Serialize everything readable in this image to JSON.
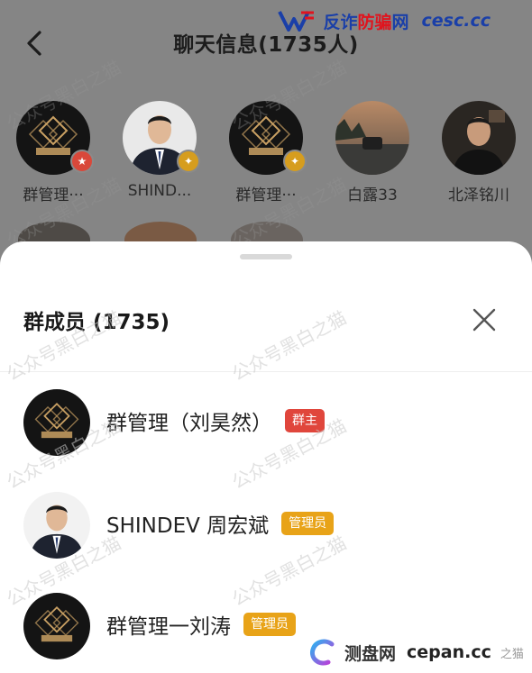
{
  "header": {
    "title": "聊天信息(1735人)"
  },
  "brand": {
    "name_prefix": "反诈",
    "name_highlight": "防骗",
    "name_suffix": "网",
    "domain": "cesc.cc"
  },
  "members_grid": [
    {
      "name": "群管理···",
      "role": "owner"
    },
    {
      "name": "SHIND...",
      "role": "admin"
    },
    {
      "name": "群管理···",
      "role": "admin"
    },
    {
      "name": "白露33",
      "role": ""
    },
    {
      "name": "北泽铭川",
      "role": ""
    }
  ],
  "sheet": {
    "title": "群成员 (1735)",
    "members": [
      {
        "name": "群管理（刘昊然）",
        "tag": "群主",
        "avatar": "logo"
      },
      {
        "name": "SHINDEV 周宏斌",
        "tag": "管理员",
        "avatar": "person"
      },
      {
        "name": "群管理一刘涛",
        "tag": "管理员",
        "avatar": "logo"
      }
    ]
  },
  "watermark": "公众号黑白之猫",
  "footer_brand": {
    "cn": "测盘网",
    "domain": "cepan.cc",
    "tail": "之猫"
  },
  "colors": {
    "owner_tag": "#e0463c",
    "admin_tag": "#e8a318",
    "logo_gold": "#c9a063"
  }
}
